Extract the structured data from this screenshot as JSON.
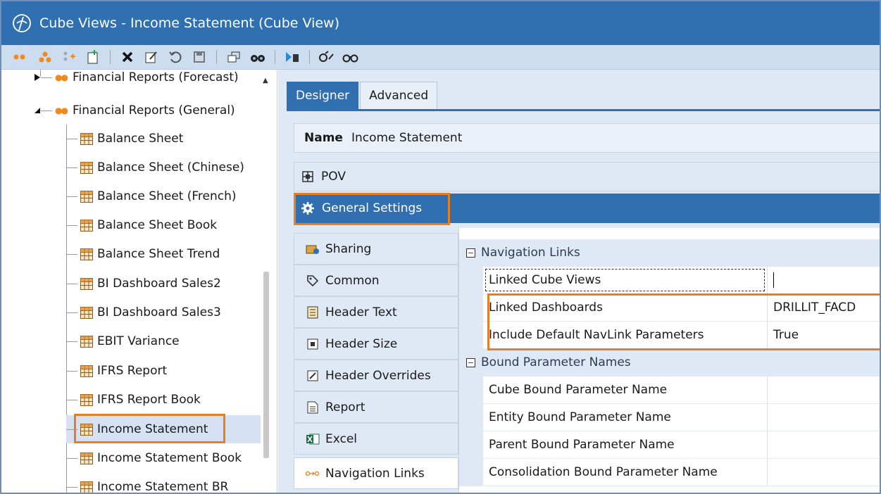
{
  "window": {
    "title": "Cube Views - Income Statement (Cube View)"
  },
  "toolbar": {
    "buttons": [
      "group-dots-icon",
      "add-group-icon",
      "add-item-icon",
      "new-icon",
      "delete-icon",
      "edit-icon",
      "undo-icon",
      "save-icon",
      "window-icon",
      "binoculars-icon",
      "run-icon",
      "find-icon",
      "compare-icon"
    ]
  },
  "tree": {
    "items": [
      {
        "label": "Financial Reports (Forecast)",
        "type": "group",
        "expanded": false
      },
      {
        "label": "Financial Reports (General)",
        "type": "group",
        "expanded": true
      },
      {
        "label": "Balance Sheet",
        "type": "view"
      },
      {
        "label": "Balance Sheet (Chinese)",
        "type": "view"
      },
      {
        "label": "Balance Sheet (French)",
        "type": "view"
      },
      {
        "label": "Balance Sheet Book",
        "type": "view"
      },
      {
        "label": "Balance Sheet Trend",
        "type": "view"
      },
      {
        "label": "BI Dashboard Sales2",
        "type": "view"
      },
      {
        "label": "BI Dashboard Sales3",
        "type": "view"
      },
      {
        "label": "EBIT Variance",
        "type": "view"
      },
      {
        "label": "IFRS Report",
        "type": "view"
      },
      {
        "label": "IFRS Report Book",
        "type": "view"
      },
      {
        "label": "Income Statement",
        "type": "view",
        "selected": true
      },
      {
        "label": "Income Statement Book",
        "type": "view"
      },
      {
        "label": "Income Statement BR",
        "type": "view"
      }
    ]
  },
  "tabs": {
    "designer": "Designer",
    "advanced": "Advanced"
  },
  "name_field": {
    "label": "Name",
    "value": "Income Statement"
  },
  "sections": {
    "pov": "POV",
    "general": "General Settings"
  },
  "side_tabs": {
    "sharing": "Sharing",
    "common": "Common",
    "header_text": "Header Text",
    "header_size": "Header Size",
    "header_overrides": "Header Overrides",
    "report": "Report",
    "excel": "Excel",
    "navigation_links": "Navigation Links"
  },
  "properties": {
    "nav_category": "Navigation Links",
    "linked_cube_views": {
      "name": "Linked Cube Views",
      "value": ""
    },
    "linked_dashboards": {
      "name": "Linked Dashboards",
      "value": "DRILLIT_FACD"
    },
    "include_default": {
      "name": "Include Default NavLink Parameters",
      "value": "True"
    },
    "bound_category": "Bound Parameter Names",
    "cube_bound": {
      "name": "Cube Bound Parameter Name",
      "value": ""
    },
    "entity_bound": {
      "name": "Entity Bound Parameter Name",
      "value": ""
    },
    "parent_bound": {
      "name": "Parent Bound Parameter Name",
      "value": ""
    },
    "consolidation_bound": {
      "name": "Consolidation Bound Parameter Name",
      "value": ""
    }
  },
  "colors": {
    "titlebar": "#3170b0",
    "highlight": "#e67e22",
    "pane_bg": "#dfe9f5"
  }
}
